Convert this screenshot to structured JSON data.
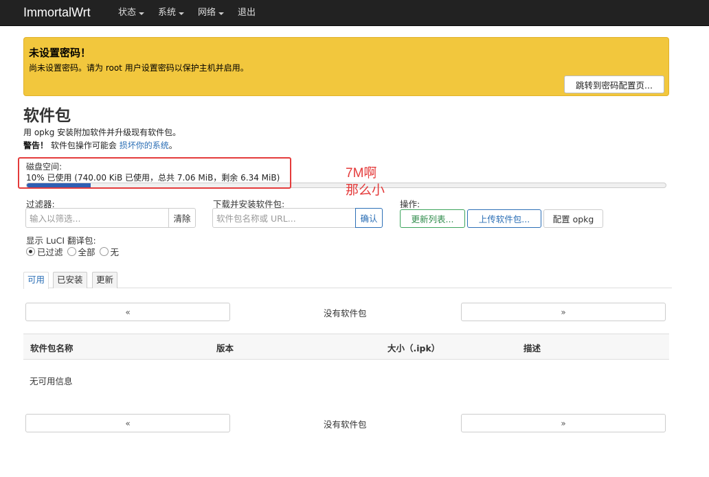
{
  "navbar": {
    "brand": "ImmortalWrt",
    "menu": [
      {
        "label": "状态",
        "has_caret": true
      },
      {
        "label": "系统",
        "has_caret": true
      },
      {
        "label": "网络",
        "has_caret": true
      },
      {
        "label": "退出",
        "has_caret": false
      }
    ]
  },
  "alert": {
    "title": "未设置密码！",
    "text": "尚未设置密码。请为 root 用户设置密码以保护主机并启用。",
    "button": "跳转到密码配置页..."
  },
  "page": {
    "title": "软件包",
    "description": "用 opkg 安装附加软件并升级现有软件包。",
    "warning_bold": "警告！",
    "warning_text": "软件包操作可能会",
    "warning_link": "损坏你的系统",
    "warning_end": "。"
  },
  "disk": {
    "label": "磁盘空间:",
    "text": "10% 已使用 (740.00 KiB 已使用，总共 7.06 MiB，剩余 6.34 MiB)",
    "used_percent": 10
  },
  "annotation": {
    "line1": "7M啊",
    "line2": "那么小",
    "color": "#e43a3a"
  },
  "filter": {
    "label": "过滤器:",
    "placeholder": "输入以筛选...",
    "clear_button": "清除"
  },
  "download": {
    "label": "下载并安装软件包:",
    "placeholder": "软件包名称或 URL...",
    "confirm_button": "确认"
  },
  "actions": {
    "label": "操作:",
    "update_lists": "更新列表...",
    "upload_package": "上传软件包...",
    "configure_opkg": "配置 opkg"
  },
  "translations": {
    "label": "显示 LuCI 翻译包:",
    "options": [
      {
        "label": "已过滤",
        "selected": true
      },
      {
        "label": "全部",
        "selected": false
      },
      {
        "label": "无",
        "selected": false
      }
    ]
  },
  "tabs": [
    {
      "label": "可用",
      "active": true
    },
    {
      "label": "已安装",
      "active": false
    },
    {
      "label": "更新",
      "active": false
    }
  ],
  "pager": {
    "prev": "«",
    "next": "»",
    "status": "没有软件包"
  },
  "table": {
    "columns": [
      "软件包名称",
      "版本",
      "大小（.ipk）",
      "描述"
    ],
    "empty_text": "无可用信息"
  }
}
